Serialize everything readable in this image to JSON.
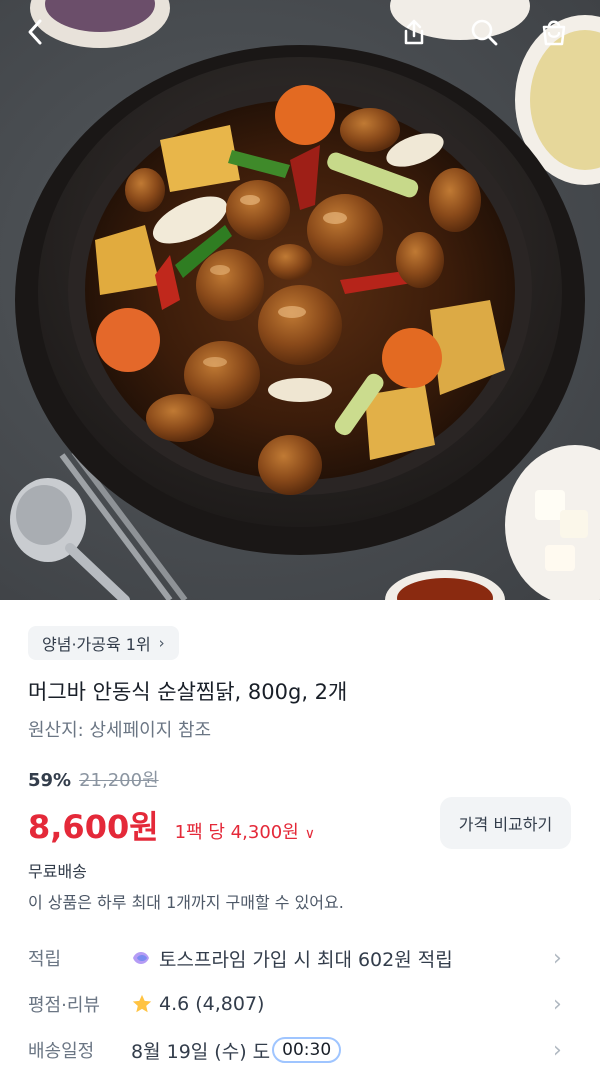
{
  "header": {
    "back_icon": "back-chevron-icon",
    "share_icon": "share-icon",
    "search_icon": "search-icon",
    "cart_icon": "shopping-bag-icon"
  },
  "product": {
    "rank_badge": "양념·가공육 1위",
    "title": "머그바 안동식 순살찜닭, 800g, 2개",
    "origin": "원산지: 상세페이지 참조",
    "discount": "59%",
    "original_price": "21,200원",
    "price": "8,600원",
    "unit_price": "1팩 당 4,300원",
    "compare_button": "가격 비교하기",
    "shipping": "무료배송",
    "purchase_limit": "이 상품은 하루 최대 1개까지 구매할 수 있어요."
  },
  "details": [
    {
      "label": "적립",
      "value": "토스프라임 가입 시 최대 602원 적립"
    },
    {
      "label": "평점·리뷰",
      "value": "4.6 (4,807)"
    },
    {
      "label": "배송일정",
      "value": "8월 19일 (수) 도",
      "badge": "00:30"
    }
  ],
  "colors": {
    "price_red": "#e42939",
    "chip_bg": "#f2f4f6",
    "star": "#ffc342",
    "timer_border": "#9fc5ff"
  }
}
